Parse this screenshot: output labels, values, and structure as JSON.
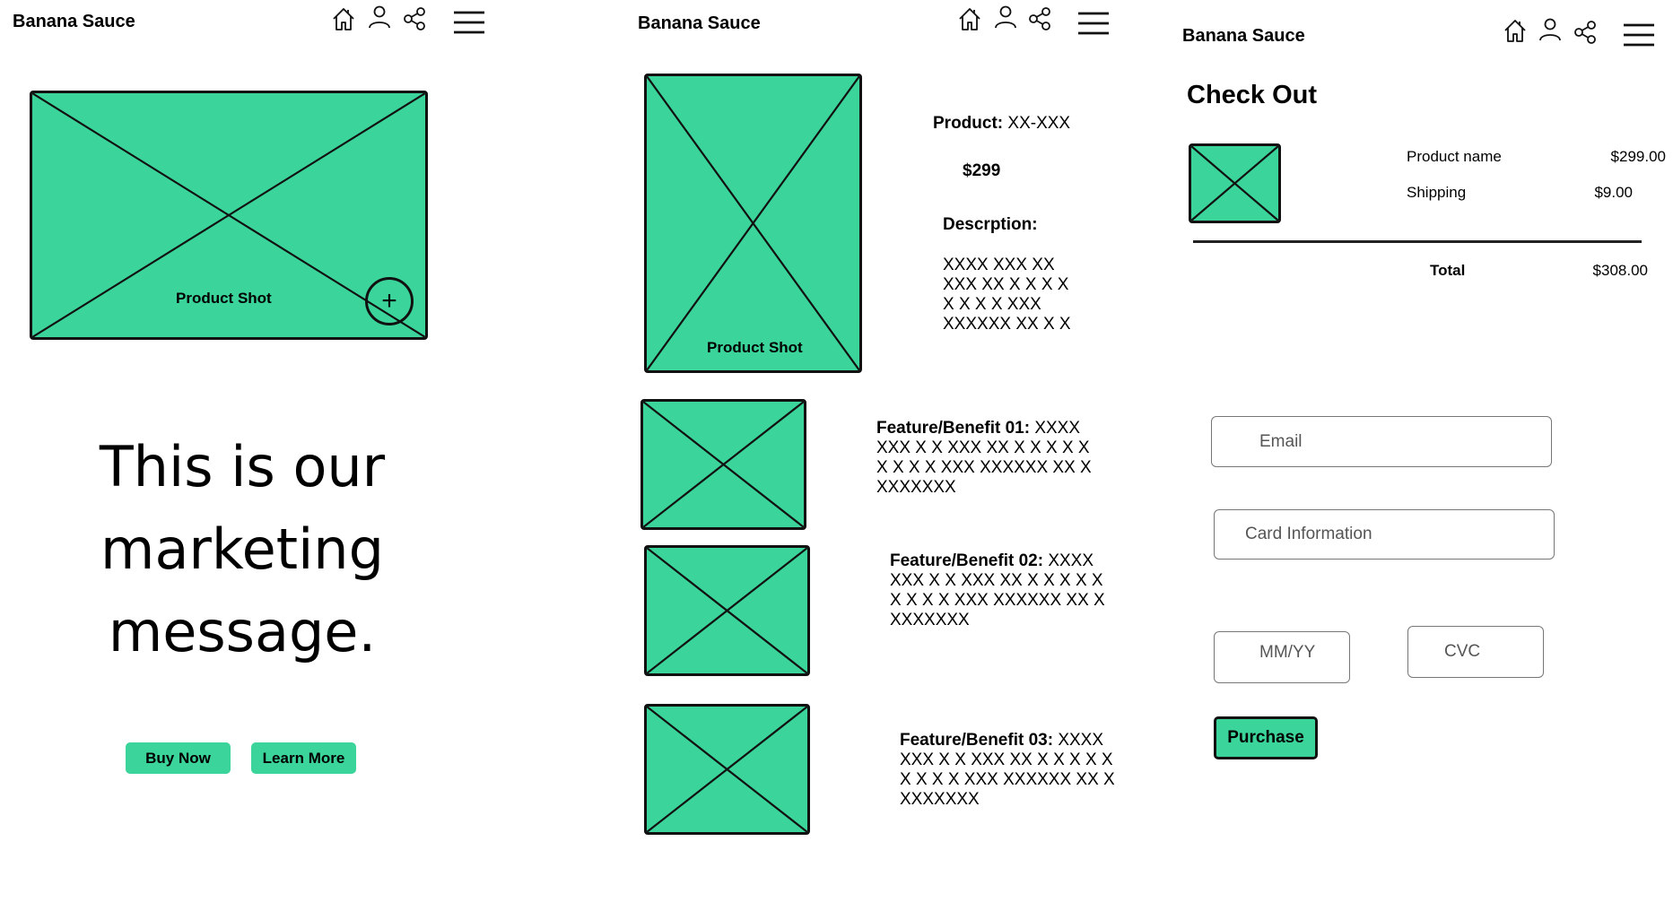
{
  "brand": "Banana Sauce",
  "colors": {
    "accent": "#3bd49b",
    "outline": "#111111",
    "field_border": "#777777"
  },
  "header_icons": [
    "home-icon",
    "user-icon",
    "share-icon",
    "hamburger-menu-icon"
  ],
  "screen1": {
    "product_shot_label": "Product Shot",
    "zoom_symbol": "+",
    "hero_lines": [
      "This is our",
      "marketing",
      "message."
    ],
    "buy_now": "Buy Now",
    "learn_more": "Learn More"
  },
  "screen2": {
    "product_shot_label": "Product Shot",
    "product_label": "Product:",
    "product_value": "XX-XXX",
    "price": "$299",
    "description_label": "Descrption:",
    "description_lines": [
      "XXXX XXX XX",
      "XXX XX X X X X",
      "X X X X XXX",
      "XXXXXX XX X X"
    ],
    "features": [
      {
        "label": "Feature/Benefit 01:",
        "first": "XXXX",
        "lines": [
          "XXX X X XXX XX X X X X X",
          "X X X X XXX XXXXXX XX X",
          "XXXXXXX"
        ]
      },
      {
        "label": "Feature/Benefit 02:",
        "first": "XXXX",
        "lines": [
          "XXX X X XXX XX X X X X X",
          "X X X X XXX XXXXXX XX X",
          "XXXXXXX"
        ]
      },
      {
        "label": "Feature/Benefit 03:",
        "first": "XXXX",
        "lines": [
          "XXX X X XXX XX X X X X X",
          "X X X X XXX XXXXXX XX X",
          "XXXXXXX"
        ]
      }
    ]
  },
  "screen3": {
    "title": "Check Out",
    "line_items": [
      {
        "name": "Product name",
        "amount": "$299.00"
      },
      {
        "name": "Shipping",
        "amount": "$9.00"
      }
    ],
    "total_label": "Total",
    "total_amount": "$308.00",
    "email_placeholder": "Email",
    "card_placeholder": "Card Information",
    "expiry_placeholder": "MM/YY",
    "cvc_placeholder": "CVC",
    "purchase": "Purchase"
  }
}
